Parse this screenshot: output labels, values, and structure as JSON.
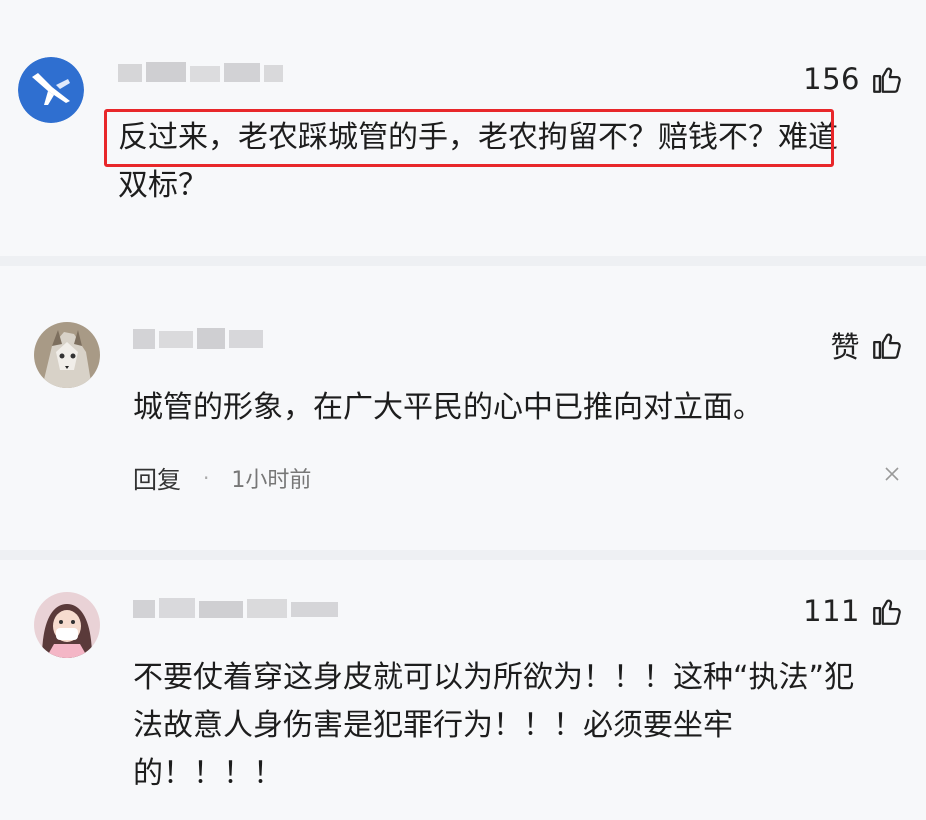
{
  "comments": [
    {
      "likes": "156",
      "text_line1": "反过来，老农踩城管的手，老农拘留不？赔钱不？难道",
      "text_line2": "双标？"
    },
    {
      "likes": "赞",
      "text": "城管的形象，在广大平民的心中已推向对立面。",
      "reply_label": "回复",
      "separator": "·",
      "time": "1小时前",
      "close_glyph": "×"
    },
    {
      "likes": "111",
      "text_line1": "不要仗着穿这身皮就可以为所欲为！！！这种“执法”犯",
      "text_line2": "法故意人身伤害是犯罪行为！！！必须要坐牢",
      "text_line3": "的！！！！"
    }
  ],
  "colors": {
    "highlight_border": "#e8272a",
    "background": "#f7f8fa",
    "avatar1_bg": "#2f6fd0"
  },
  "icons": [
    "thumb-up-icon",
    "close-icon",
    "jet-avatar-icon"
  ]
}
